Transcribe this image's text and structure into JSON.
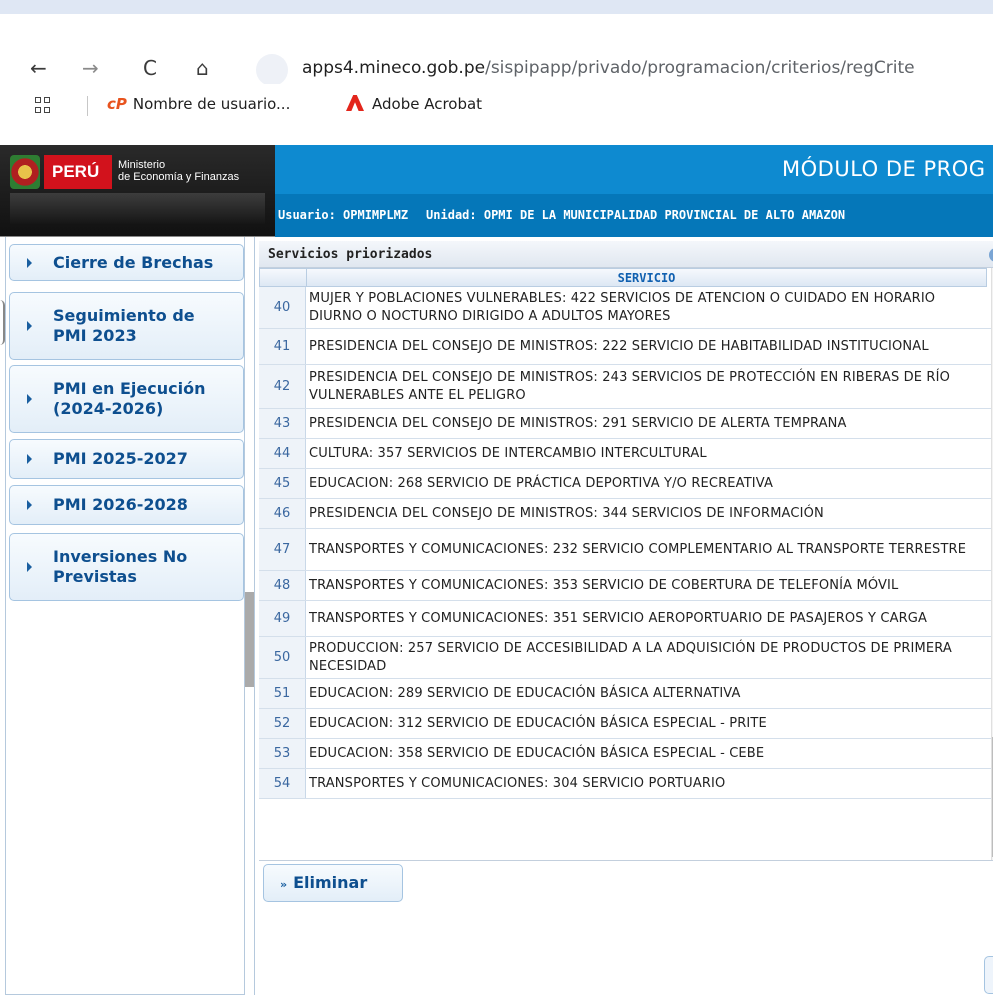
{
  "browser": {
    "url_host": "apps4.mineco.gob.pe",
    "url_path": "/sispipapp/privado/programacion/criterios/regCrite",
    "nav": {
      "back": "←",
      "forward": "→",
      "reload": "C",
      "home": "⌂"
    },
    "bookmarks": [
      {
        "label": "Nombre de usuario...",
        "icon": "cp-logo",
        "icon_text": "cP"
      },
      {
        "label": "Adobe Acrobat",
        "icon": "acrobat-icon"
      }
    ]
  },
  "header": {
    "country": "PERÚ",
    "ministry_line1": "Ministerio",
    "ministry_line2": "de Economía y Finanzas",
    "module_title": "MÓDULO DE PROG",
    "user": "Usuario: OPMIMPLMZ",
    "unit": "Unidad: OPMI DE LA MUNICIPALIDAD PROVINCIAL DE ALTO AMAZON"
  },
  "sidebar": {
    "items": [
      {
        "line1": "Cierre de Brechas",
        "line2": ""
      },
      {
        "line1": "Seguimiento de",
        "line2": "PMI 2023"
      },
      {
        "line1": "PMI en Ejecución",
        "line2": "(2024-2026)"
      },
      {
        "line1": "PMI 2025-2027",
        "line2": ""
      },
      {
        "line1": "PMI 2026-2028",
        "line2": ""
      },
      {
        "line1": "Inversiones No",
        "line2": "Previstas"
      }
    ]
  },
  "panel": {
    "title": "Servicios priorizados",
    "column_header": "SERVICIO",
    "rows": [
      {
        "num": "40",
        "text": "MUJER Y POBLACIONES VULNERABLES: 422 SERVICIOS DE ATENCION O CUIDADO EN HORARIO DIURNO O NOCTURNO DIRIGIDO A ADULTOS MAYORES"
      },
      {
        "num": "41",
        "text": "PRESIDENCIA DEL CONSEJO DE MINISTROS: 222 SERVICIO DE HABITABILIDAD INSTITUCIONAL"
      },
      {
        "num": "42",
        "text": "PRESIDENCIA DEL CONSEJO DE MINISTROS: 243 SERVICIOS DE PROTECCIÓN EN RIBERAS DE RÍO VULNERABLES ANTE EL PELIGRO"
      },
      {
        "num": "43",
        "text": "PRESIDENCIA DEL CONSEJO DE MINISTROS: 291 SERVICIO DE ALERTA TEMPRANA"
      },
      {
        "num": "44",
        "text": "CULTURA: 357 SERVICIOS DE INTERCAMBIO INTERCULTURAL"
      },
      {
        "num": "45",
        "text": "EDUCACION: 268 SERVICIO DE PRÁCTICA DEPORTIVA Y/O RECREATIVA"
      },
      {
        "num": "46",
        "text": "PRESIDENCIA DEL CONSEJO DE MINISTROS: 344 SERVICIOS DE INFORMACIÓN"
      },
      {
        "num": "47",
        "text": "TRANSPORTES Y COMUNICACIONES: 232 SERVICIO COMPLEMENTARIO AL TRANSPORTE TERRESTRE"
      },
      {
        "num": "48",
        "text": "TRANSPORTES Y COMUNICACIONES: 353 SERVICIO DE COBERTURA DE TELEFONÍA MÓVIL"
      },
      {
        "num": "49",
        "text": "TRANSPORTES Y COMUNICACIONES: 351 SERVICIO AEROPORTUARIO DE PASAJEROS Y CARGA"
      },
      {
        "num": "50",
        "text": "PRODUCCION: 257 SERVICIO DE ACCESIBILIDAD A LA ADQUISICIÓN DE PRODUCTOS DE PRIMERA NECESIDAD"
      },
      {
        "num": "51",
        "text": "EDUCACION: 289 SERVICIO DE EDUCACIÓN BÁSICA ALTERNATIVA"
      },
      {
        "num": "52",
        "text": "EDUCACION: 312 SERVICIO DE EDUCACIÓN BÁSICA ESPECIAL - PRITE"
      },
      {
        "num": "53",
        "text": "EDUCACION: 358 SERVICIO DE EDUCACIÓN BÁSICA ESPECIAL - CEBE"
      },
      {
        "num": "54",
        "text": "TRANSPORTES Y COMUNICACIONES: 304 SERVICIO PORTUARIO"
      }
    ],
    "delete_button": "Eliminar",
    "delete_icon": "»"
  },
  "colors": {
    "title_bar": "#0e8ad0",
    "user_bar": "#0577b9",
    "sidebar_text": "#0e4f8f",
    "flag_red": "#d2121c"
  }
}
